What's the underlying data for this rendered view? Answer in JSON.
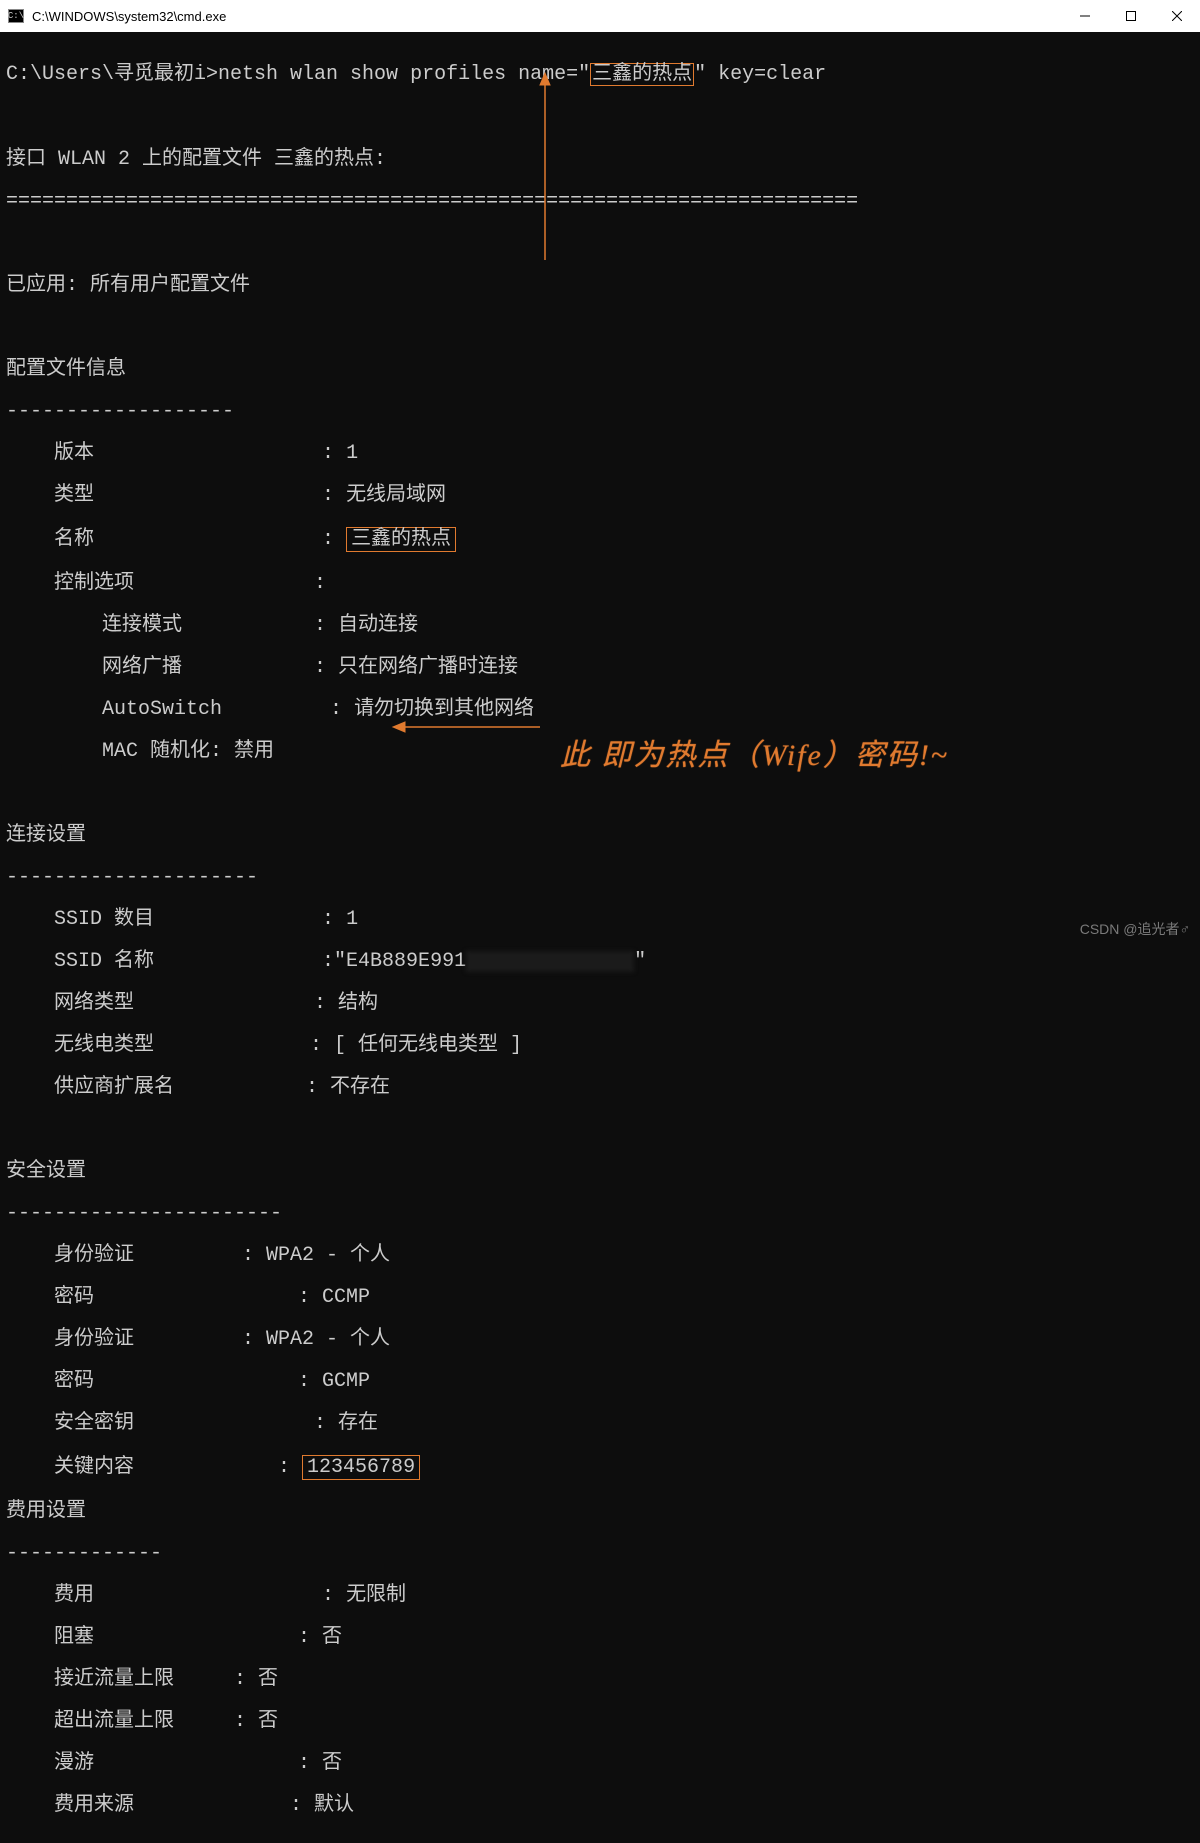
{
  "window": {
    "title": "C:\\WINDOWS\\system32\\cmd.exe"
  },
  "prompt": {
    "prefix": "C:\\Users\\寻觅最初i>",
    "cmd_before": "netsh wlan show profiles name=\"",
    "profile_name": "三鑫的热点",
    "cmd_after": "\" key=clear"
  },
  "header": {
    "interface_line": "接口 WLAN 2 上的配置文件 三鑫的热点:",
    "sep": "=======================================================================",
    "applied": "已应用: 所有用户配置文件"
  },
  "sections": {
    "profile_info": {
      "title": "配置文件信息",
      "dashes": "-------------------",
      "version_label": "    版本                   : ",
      "version_value": "1",
      "type_label": "    类型                   : ",
      "type_value": "无线局域网",
      "name_label": "    名称                   : ",
      "name_value": "三鑫的热点",
      "ctrl_label": "    控制选项               :",
      "conn_label": "        连接模式           : ",
      "conn_value": "自动连接",
      "bcast_label": "        网络广播           : ",
      "bcast_value": "只在网络广播时连接",
      "autosw_label": "        AutoSwitch         : ",
      "autosw_value": "请勿切换到其他网络",
      "mac_label": "        MAC 随机化: 禁用"
    },
    "conn": {
      "title": "连接设置",
      "dashes": "---------------------",
      "ssid_num_label": "    SSID 数目              : ",
      "ssid_num_value": "1",
      "ssid_name_label": "    SSID 名称              :",
      "ssid_name_value": "\"E4B889E991",
      "ssid_name_blur": "XXXXXXXXXXXXXX",
      "ssid_name_after": "\"",
      "nettype_label": "    网络类型               : ",
      "nettype_value": "结构",
      "radio_label": "    无线电类型             : ",
      "radio_value": "[ 任何无线电类型 ]",
      "vendor_label": "    供应商扩展名           : ",
      "vendor_value": "不存在"
    },
    "sec": {
      "title": "安全设置",
      "dashes": "-----------------------",
      "auth1_label": "    身份验证         : ",
      "auth1_value": "WPA2 - 个人",
      "cipher1_label": "    密码                 : ",
      "cipher1_value": "CCMP",
      "auth2_label": "    身份验证         : ",
      "auth2_value": "WPA2 - 个人",
      "cipher2_label": "    密码                 : ",
      "cipher2_value": "GCMP",
      "seckey_label": "    安全密钥               : ",
      "seckey_value": "存在",
      "keycontent_label": "    关键内容            : ",
      "keycontent_value": "123456789"
    },
    "cost": {
      "title": "费用设置",
      "dashes": "-------------",
      "cost_label": "    费用                   : ",
      "cost_value": "无限制",
      "congest_label": "    阻塞                 : ",
      "congest_value": "否",
      "near_label": "    接近流量上限     : ",
      "near_value": "否",
      "over_label": "    超出流量上限     : ",
      "over_value": "否",
      "roam_label": "    漫游                 : ",
      "roam_value": "否",
      "src_label": "    费用来源             : ",
      "src_value": "默认"
    }
  },
  "annotation": {
    "text": "此 即为热点（Wife）密码!~"
  },
  "watermark": "CSDN @追光者♂"
}
